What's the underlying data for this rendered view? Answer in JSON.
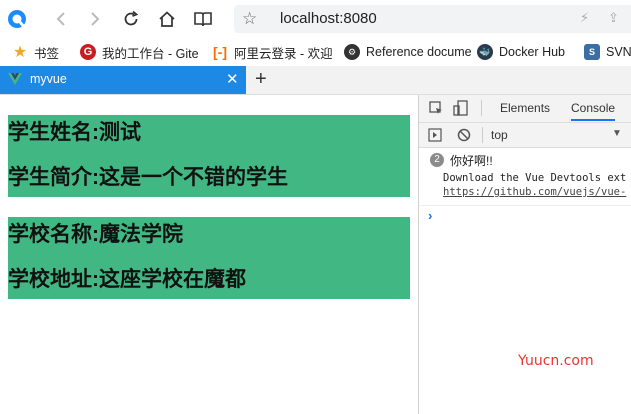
{
  "toolbar": {
    "address": "localhost:8080"
  },
  "bookmarks": [
    {
      "label": "书签",
      "icon": "star-icon",
      "color": "#f5a623"
    },
    {
      "label": "我的工作台 - Gite",
      "icon": "gitee-icon",
      "color": "#c71d23"
    },
    {
      "label": "阿里云登录 - 欢迎",
      "icon": "aliyun-icon",
      "color": "#ff6a00"
    },
    {
      "label": "Reference docume",
      "icon": "reference-icon",
      "color": "#333333"
    },
    {
      "label": "Docker Hub",
      "icon": "docker-icon",
      "color": "#2b3a4a"
    },
    {
      "label": "SVN",
      "icon": "svn-icon",
      "color": "#3a6ea5"
    }
  ],
  "tab": {
    "title": "myvue"
  },
  "page": {
    "student_name": "学生姓名:测试",
    "student_intro": "学生简介:这是一个不错的学生",
    "school_name": "学校名称:魔法学院",
    "school_address": "学校地址:这座学校在魔都",
    "box_color": "#41b883"
  },
  "devtools": {
    "tabs": [
      "Elements",
      "Console"
    ],
    "active_tab": "Console",
    "context": "top",
    "log_count": "2",
    "log_message": "你好啊!!",
    "devtools_notice": "Download the Vue Devtools ext",
    "devtools_link": "https://github.com/vuejs/vue-"
  },
  "watermark": "Yuucn.com"
}
